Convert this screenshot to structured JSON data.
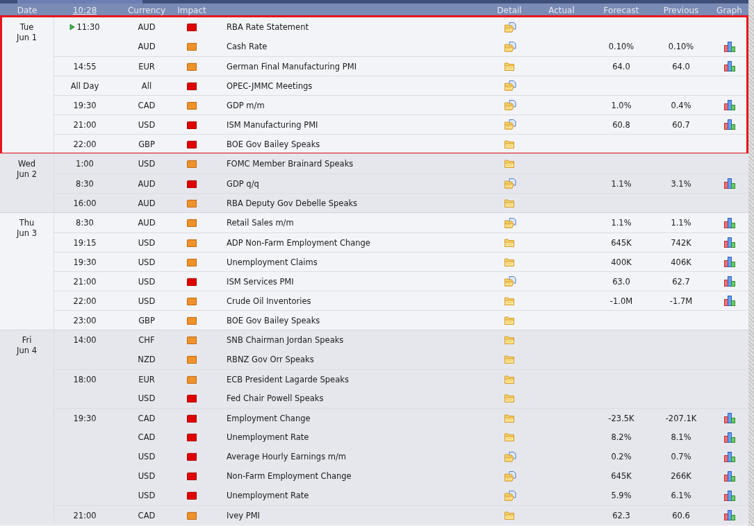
{
  "header": {
    "date": "Date",
    "clock": "10:28",
    "currency": "Currency",
    "impact": "Impact",
    "detail": "Detail",
    "actual": "Actual",
    "forecast": "Forecast",
    "previous": "Previous",
    "graph": "Graph"
  },
  "days": [
    {
      "weekday": "Tue",
      "date": "Jun 1",
      "highlighted": true,
      "blocks": [
        {
          "time": "11:30",
          "next": true,
          "events": [
            {
              "currency": "AUD",
              "high_impact": true,
              "name": "RBA Rate Statement",
              "document": true,
              "graph": false
            },
            {
              "currency": "AUD",
              "high_impact": false,
              "name": "Cash Rate",
              "document": true,
              "forecast": "0.10%",
              "previous": "0.10%",
              "graph": true
            }
          ]
        },
        {
          "time": "14:55",
          "next": false,
          "events": [
            {
              "currency": "EUR",
              "high_impact": false,
              "name": "German Final Manufacturing PMI",
              "document": false,
              "forecast": "64.0",
              "previous": "64.0",
              "graph": true
            }
          ]
        },
        {
          "time": "All Day",
          "next": false,
          "events": [
            {
              "currency": "All",
              "high_impact": true,
              "name": "OPEC-JMMC Meetings",
              "document": true,
              "graph": false
            }
          ]
        },
        {
          "time": "19:30",
          "next": false,
          "events": [
            {
              "currency": "CAD",
              "high_impact": false,
              "name": "GDP m/m",
              "document": true,
              "forecast": "1.0%",
              "previous": "0.4%",
              "graph": true
            }
          ]
        },
        {
          "time": "21:00",
          "next": false,
          "events": [
            {
              "currency": "USD",
              "high_impact": true,
              "name": "ISM Manufacturing PMI",
              "document": true,
              "forecast": "60.8",
              "previous": "60.7",
              "graph": true
            }
          ]
        },
        {
          "time": "22:00",
          "next": false,
          "events": [
            {
              "currency": "GBP",
              "high_impact": true,
              "name": "BOE Gov Bailey Speaks",
              "document": false,
              "graph": false
            }
          ]
        }
      ]
    },
    {
      "weekday": "Wed",
      "date": "Jun 2",
      "highlighted": false,
      "blocks": [
        {
          "time": "1:00",
          "next": false,
          "events": [
            {
              "currency": "USD",
              "high_impact": false,
              "name": "FOMC Member Brainard Speaks",
              "document": false,
              "graph": false
            }
          ]
        },
        {
          "time": "8:30",
          "next": false,
          "events": [
            {
              "currency": "AUD",
              "high_impact": true,
              "name": "GDP q/q",
              "document": true,
              "forecast": "1.1%",
              "previous": "3.1%",
              "graph": true
            }
          ]
        },
        {
          "time": "16:00",
          "next": false,
          "events": [
            {
              "currency": "AUD",
              "high_impact": false,
              "name": "RBA Deputy Gov Debelle Speaks",
              "document": false,
              "graph": false
            }
          ]
        }
      ]
    },
    {
      "weekday": "Thu",
      "date": "Jun 3",
      "highlighted": false,
      "blocks": [
        {
          "time": "8:30",
          "next": false,
          "events": [
            {
              "currency": "AUD",
              "high_impact": false,
              "name": "Retail Sales m/m",
              "document": true,
              "forecast": "1.1%",
              "previous": "1.1%",
              "graph": true
            }
          ]
        },
        {
          "time": "19:15",
          "next": false,
          "events": [
            {
              "currency": "USD",
              "high_impact": false,
              "name": "ADP Non-Farm Employment Change",
              "document": false,
              "forecast": "645K",
              "previous": "742K",
              "graph": true
            }
          ]
        },
        {
          "time": "19:30",
          "next": false,
          "events": [
            {
              "currency": "USD",
              "high_impact": false,
              "name": "Unemployment Claims",
              "document": false,
              "forecast": "400K",
              "previous": "406K",
              "graph": true
            }
          ]
        },
        {
          "time": "21:00",
          "next": false,
          "events": [
            {
              "currency": "USD",
              "high_impact": true,
              "name": "ISM Services PMI",
              "document": true,
              "forecast": "63.0",
              "previous": "62.7",
              "graph": true
            }
          ]
        },
        {
          "time": "22:00",
          "next": false,
          "events": [
            {
              "currency": "USD",
              "high_impact": false,
              "name": "Crude Oil Inventories",
              "document": false,
              "forecast": "-1.0M",
              "previous": "-1.7M",
              "graph": true
            }
          ]
        },
        {
          "time": "23:00",
          "next": false,
          "events": [
            {
              "currency": "GBP",
              "high_impact": false,
              "name": "BOE Gov Bailey Speaks",
              "document": false,
              "graph": false
            }
          ]
        }
      ]
    },
    {
      "weekday": "Fri",
      "date": "Jun 4",
      "highlighted": false,
      "blocks": [
        {
          "time": "14:00",
          "next": false,
          "events": [
            {
              "currency": "CHF",
              "high_impact": false,
              "name": "SNB Chairman Jordan Speaks",
              "document": false,
              "graph": false
            },
            {
              "currency": "NZD",
              "high_impact": false,
              "name": "RBNZ Gov Orr Speaks",
              "document": false,
              "graph": false
            }
          ]
        },
        {
          "time": "18:00",
          "next": false,
          "events": [
            {
              "currency": "EUR",
              "high_impact": false,
              "name": "ECB President Lagarde Speaks",
              "document": false,
              "graph": false
            },
            {
              "currency": "USD",
              "high_impact": true,
              "name": "Fed Chair Powell Speaks",
              "document": false,
              "graph": false
            }
          ]
        },
        {
          "time": "19:30",
          "next": false,
          "events": [
            {
              "currency": "CAD",
              "high_impact": true,
              "name": "Employment Change",
              "document": false,
              "forecast": "-23.5K",
              "previous": "-207.1K",
              "graph": true
            },
            {
              "currency": "CAD",
              "high_impact": true,
              "name": "Unemployment Rate",
              "document": false,
              "forecast": "8.2%",
              "previous": "8.1%",
              "graph": true
            },
            {
              "currency": "USD",
              "high_impact": true,
              "name": "Average Hourly Earnings m/m",
              "document": true,
              "forecast": "0.2%",
              "previous": "0.7%",
              "graph": true
            },
            {
              "currency": "USD",
              "high_impact": true,
              "name": "Non-Farm Employment Change",
              "document": true,
              "forecast": "645K",
              "previous": "266K",
              "graph": true
            },
            {
              "currency": "USD",
              "high_impact": true,
              "name": "Unemployment Rate",
              "document": true,
              "forecast": "5.9%",
              "previous": "6.1%",
              "graph": true
            }
          ]
        },
        {
          "time": "21:00",
          "next": false,
          "events": [
            {
              "currency": "CAD",
              "high_impact": false,
              "name": "Ivey PMI",
              "document": false,
              "forecast": "62.3",
              "previous": "60.6",
              "graph": true
            }
          ]
        }
      ]
    }
  ]
}
